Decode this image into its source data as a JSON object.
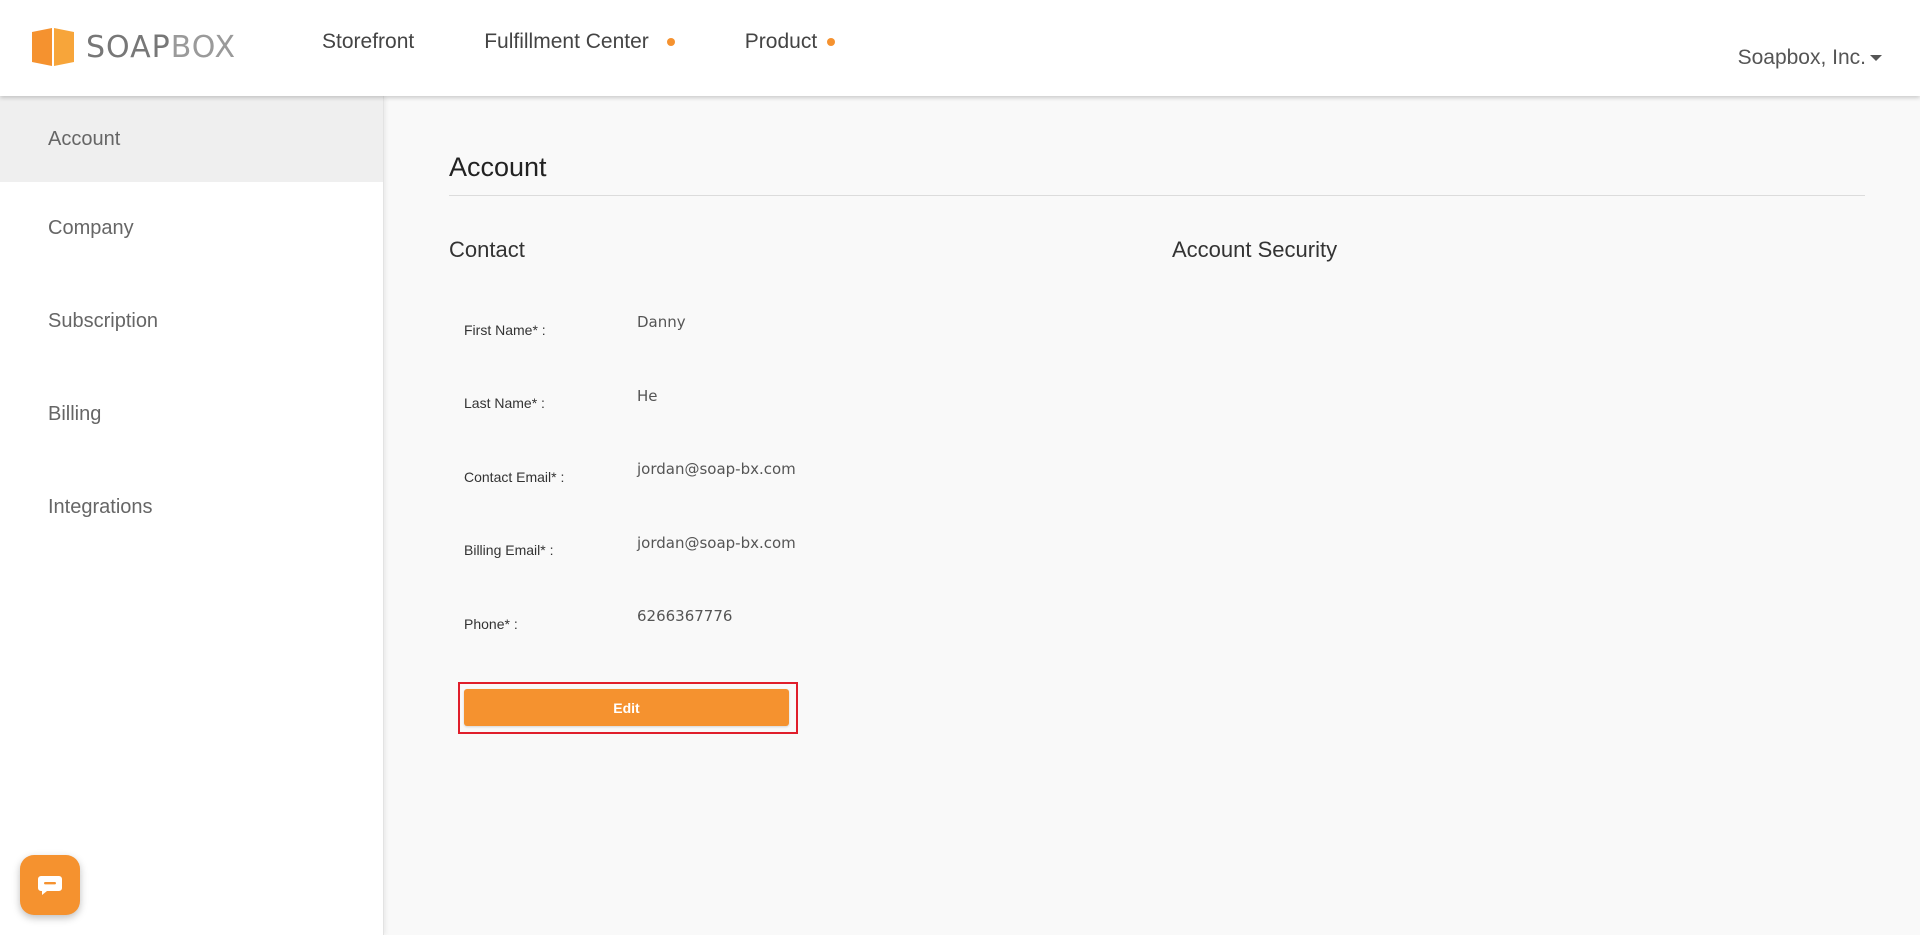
{
  "brand": {
    "name_part1": "SOAP",
    "name_part2": "BOX",
    "accent_color": "#f5922f"
  },
  "nav": {
    "items": [
      {
        "label": "Storefront",
        "has_dot": false
      },
      {
        "label": "Fulfillment Center",
        "has_dot": true
      },
      {
        "label": "Product",
        "has_dot": true
      }
    ],
    "company_menu_label": "Soapbox, Inc."
  },
  "sidebar": {
    "items": [
      {
        "label": "Account",
        "active": true
      },
      {
        "label": "Company",
        "active": false
      },
      {
        "label": "Subscription",
        "active": false
      },
      {
        "label": "Billing",
        "active": false
      },
      {
        "label": "Integrations",
        "active": false
      }
    ]
  },
  "main": {
    "title": "Account",
    "contact": {
      "title": "Contact",
      "fields": [
        {
          "label": "First Name* :",
          "value": "Danny"
        },
        {
          "label": "Last Name* :",
          "value": "He"
        },
        {
          "label": "Contact Email* :",
          "value": "jordan@soap-bx.com"
        },
        {
          "label": "Billing Email* :",
          "value": "jordan@soap-bx.com"
        },
        {
          "label": "Phone* :",
          "value": "6266367776"
        }
      ],
      "edit_label": "Edit"
    },
    "security": {
      "title": "Account Security"
    }
  },
  "chat": {
    "icon": "chat-icon"
  }
}
